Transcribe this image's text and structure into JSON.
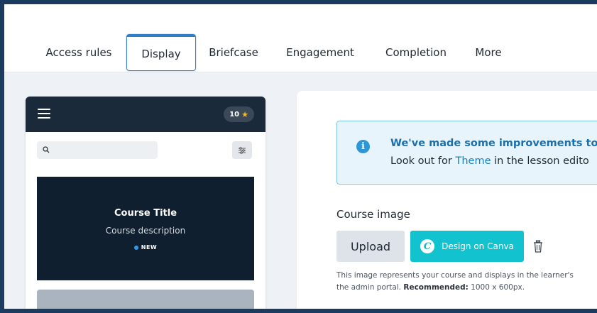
{
  "tabs": [
    {
      "label": "Access rules",
      "active": false
    },
    {
      "label": "Display",
      "active": true
    },
    {
      "label": "Briefcase",
      "active": false
    },
    {
      "label": "Engagement",
      "active": false
    },
    {
      "label": "Completion",
      "active": false
    },
    {
      "label": "More",
      "active": false
    }
  ],
  "preview": {
    "points": "10",
    "course_title": "Course Title",
    "course_description": "Course description",
    "new_badge": "NEW"
  },
  "info": {
    "title": "We've made some improvements to b",
    "text_before": "Look out for ",
    "link": "Theme",
    "text_after": " in the lesson edito"
  },
  "course_image": {
    "label": "Course image",
    "upload_label": "Upload",
    "canva_label": "Design on Canva",
    "canva_logo": "C",
    "help_line1": "This image represents your course and displays in the learner's",
    "help_line2_prefix": "the admin portal. ",
    "help_recommended_label": "Recommended:",
    "help_recommended_value": " 1000 x 600px."
  },
  "colors": {
    "accent": "#2f7fc8",
    "canva": "#12c2cf",
    "info_bg": "#e8f4fb",
    "info_border": "#7fc3e8",
    "phone_header": "#1b2a3a",
    "frame": "#1d3a5f"
  }
}
